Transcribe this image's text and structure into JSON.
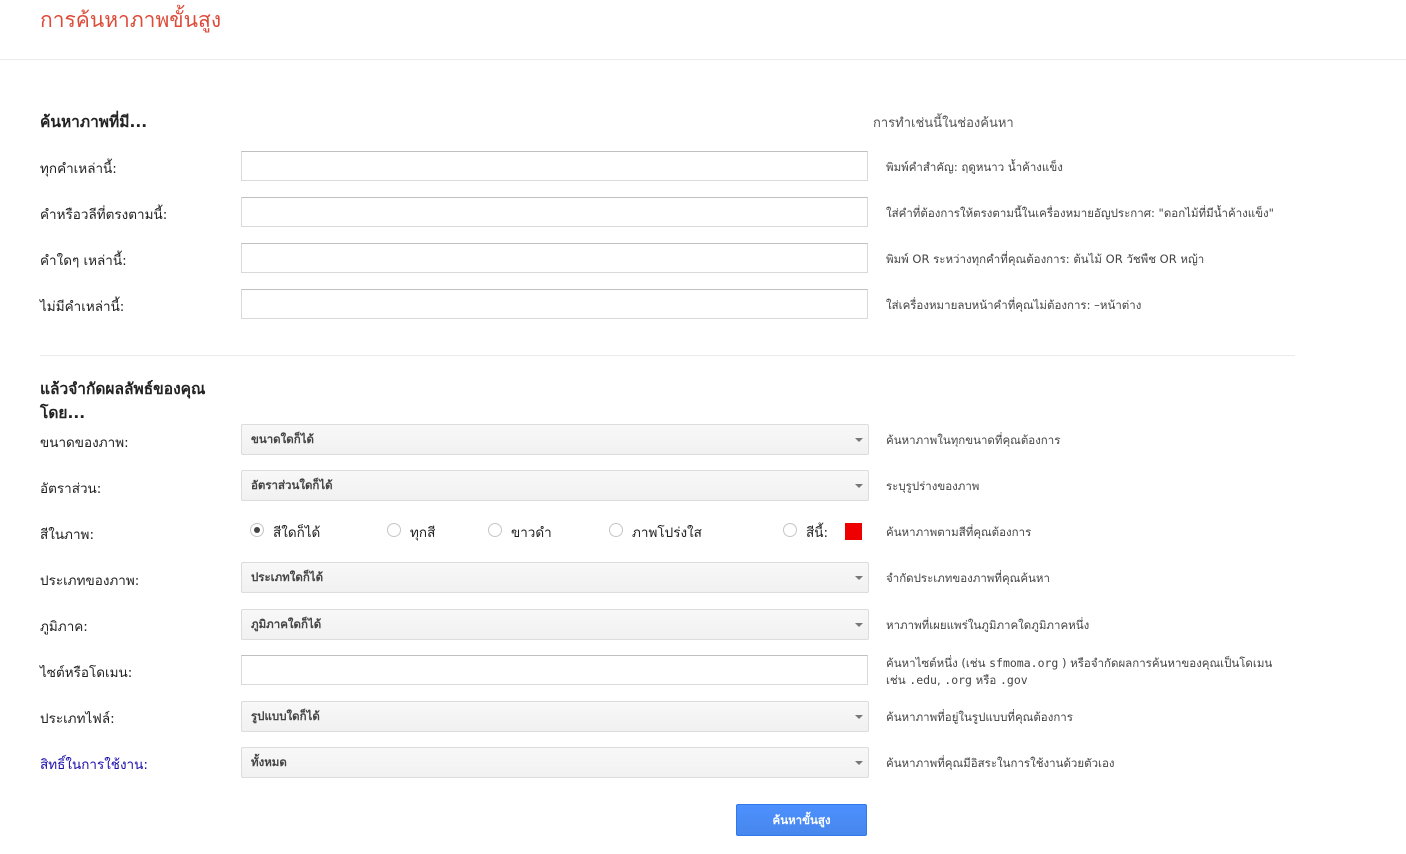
{
  "page": {
    "title": "การค้นหาภาพขั้นสูง"
  },
  "section1": {
    "title": "ค้นหาภาพที่มี...",
    "hint_header": "การทำเช่นนี้ในช่องค้นหา",
    "rows": [
      {
        "label": "ทุกคำเหล่านี้:",
        "value": "",
        "hint": "พิมพ์คำสำคัญ: ฤดูหนาว น้ำค้างแข็ง"
      },
      {
        "label": "คำหรือวลีที่ตรงตามนี้:",
        "value": "",
        "hint": "ใส่คำที่ต้องการให้ตรงตามนี้ในเครื่องหมายอัญประกาศ: \"ดอกไม้ที่มีน้ำค้างแข็ง\""
      },
      {
        "label": "คำใดๆ เหล่านี้:",
        "value": "",
        "hint": "พิมพ์ OR ระหว่างทุกคำที่คุณต้องการ: ต้นไม้ OR วัชพืช OR หญ้า"
      },
      {
        "label": "ไม่มีคำเหล่านี้:",
        "value": "",
        "hint": "ใส่เครื่องหมายลบหน้าคำที่คุณไม่ต้องการ: –หน้าต่าง"
      }
    ]
  },
  "section2": {
    "title_line1": "แล้วจำกัดผลลัพธ์ของคุณ",
    "title_line2": "โดย...",
    "size": {
      "label": "ขนาดของภาพ:",
      "value": "ขนาดใดก็ได้",
      "hint": "ค้นหาภาพในทุกขนาดที่คุณต้องการ"
    },
    "aspect": {
      "label": "อัตราส่วน:",
      "value": "อัตราส่วนใดก็ได้",
      "hint": "ระบุรูปร่างของภาพ"
    },
    "color": {
      "label": "สีในภาพ:",
      "options": [
        "สีใดก็ได้",
        "ทุกสี",
        "ขาวดำ",
        "ภาพโปร่งใส",
        "สีนี้:"
      ],
      "selected": "สีใดก็ได้",
      "swatch_color": "#ee0000",
      "hint": "ค้นหาภาพตามสีที่คุณต้องการ"
    },
    "type": {
      "label": "ประเภทของภาพ:",
      "value": "ประเภทใดก็ได้",
      "hint": "จำกัดประเภทของภาพที่คุณค้นหา"
    },
    "region": {
      "label": "ภูมิภาค:",
      "value": "ภูมิภาคใดก็ได้",
      "hint": "หาภาพที่เผยแพร่ในภูมิภาคใดภูมิภาคหนึ่ง"
    },
    "site": {
      "label": "ไซต์หรือโดเมน:",
      "value": "",
      "hint_a": "ค้นหาไซต์หนึ่ง (เช่น ",
      "hint_code1": "sfmoma.org",
      "hint_b": " ) หรือจำกัดผลการค้นหาของคุณเป็นโดเมน",
      "hint_c": "เช่น ",
      "hint_code2": ".edu",
      "hint_d": ", ",
      "hint_code3": ".org",
      "hint_e": " หรือ ",
      "hint_code4": ".gov"
    },
    "filetype": {
      "label": "ประเภทไฟล์:",
      "value": "รูปแบบใดก็ได้",
      "hint": "ค้นหาภาพที่อยู่ในรูปแบบที่คุณต้องการ"
    },
    "rights": {
      "label": "สิทธิ์ในการใช้งาน:",
      "value": "ทั้งหมด",
      "hint": "ค้นหาภาพที่คุณมีอิสระในการใช้งานด้วยตัวเอง"
    }
  },
  "submit": {
    "label": "ค้นหาขั้นสูง"
  }
}
